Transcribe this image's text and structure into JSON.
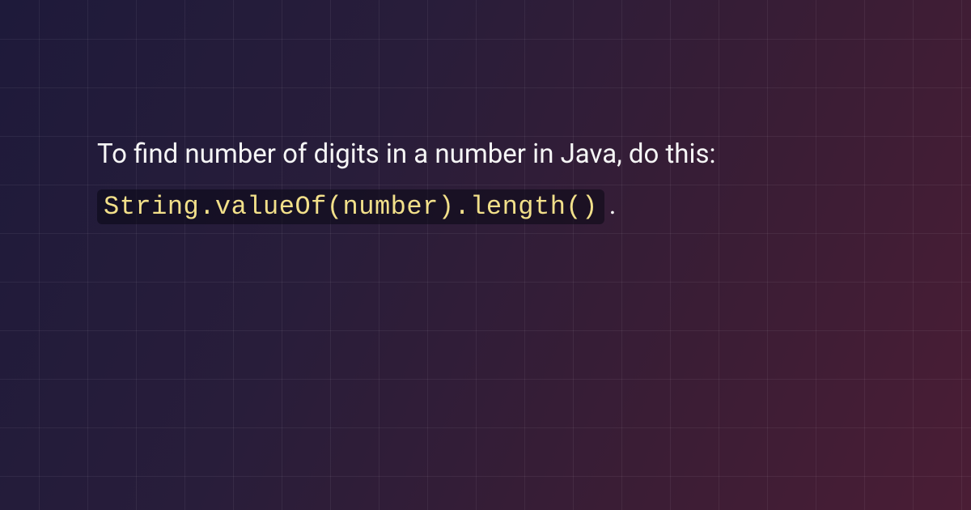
{
  "content": {
    "intro_text": "To find number of digits in a number in Java, do this: ",
    "code_snippet": "String.valueOf(number).length()",
    "trailing": "."
  }
}
